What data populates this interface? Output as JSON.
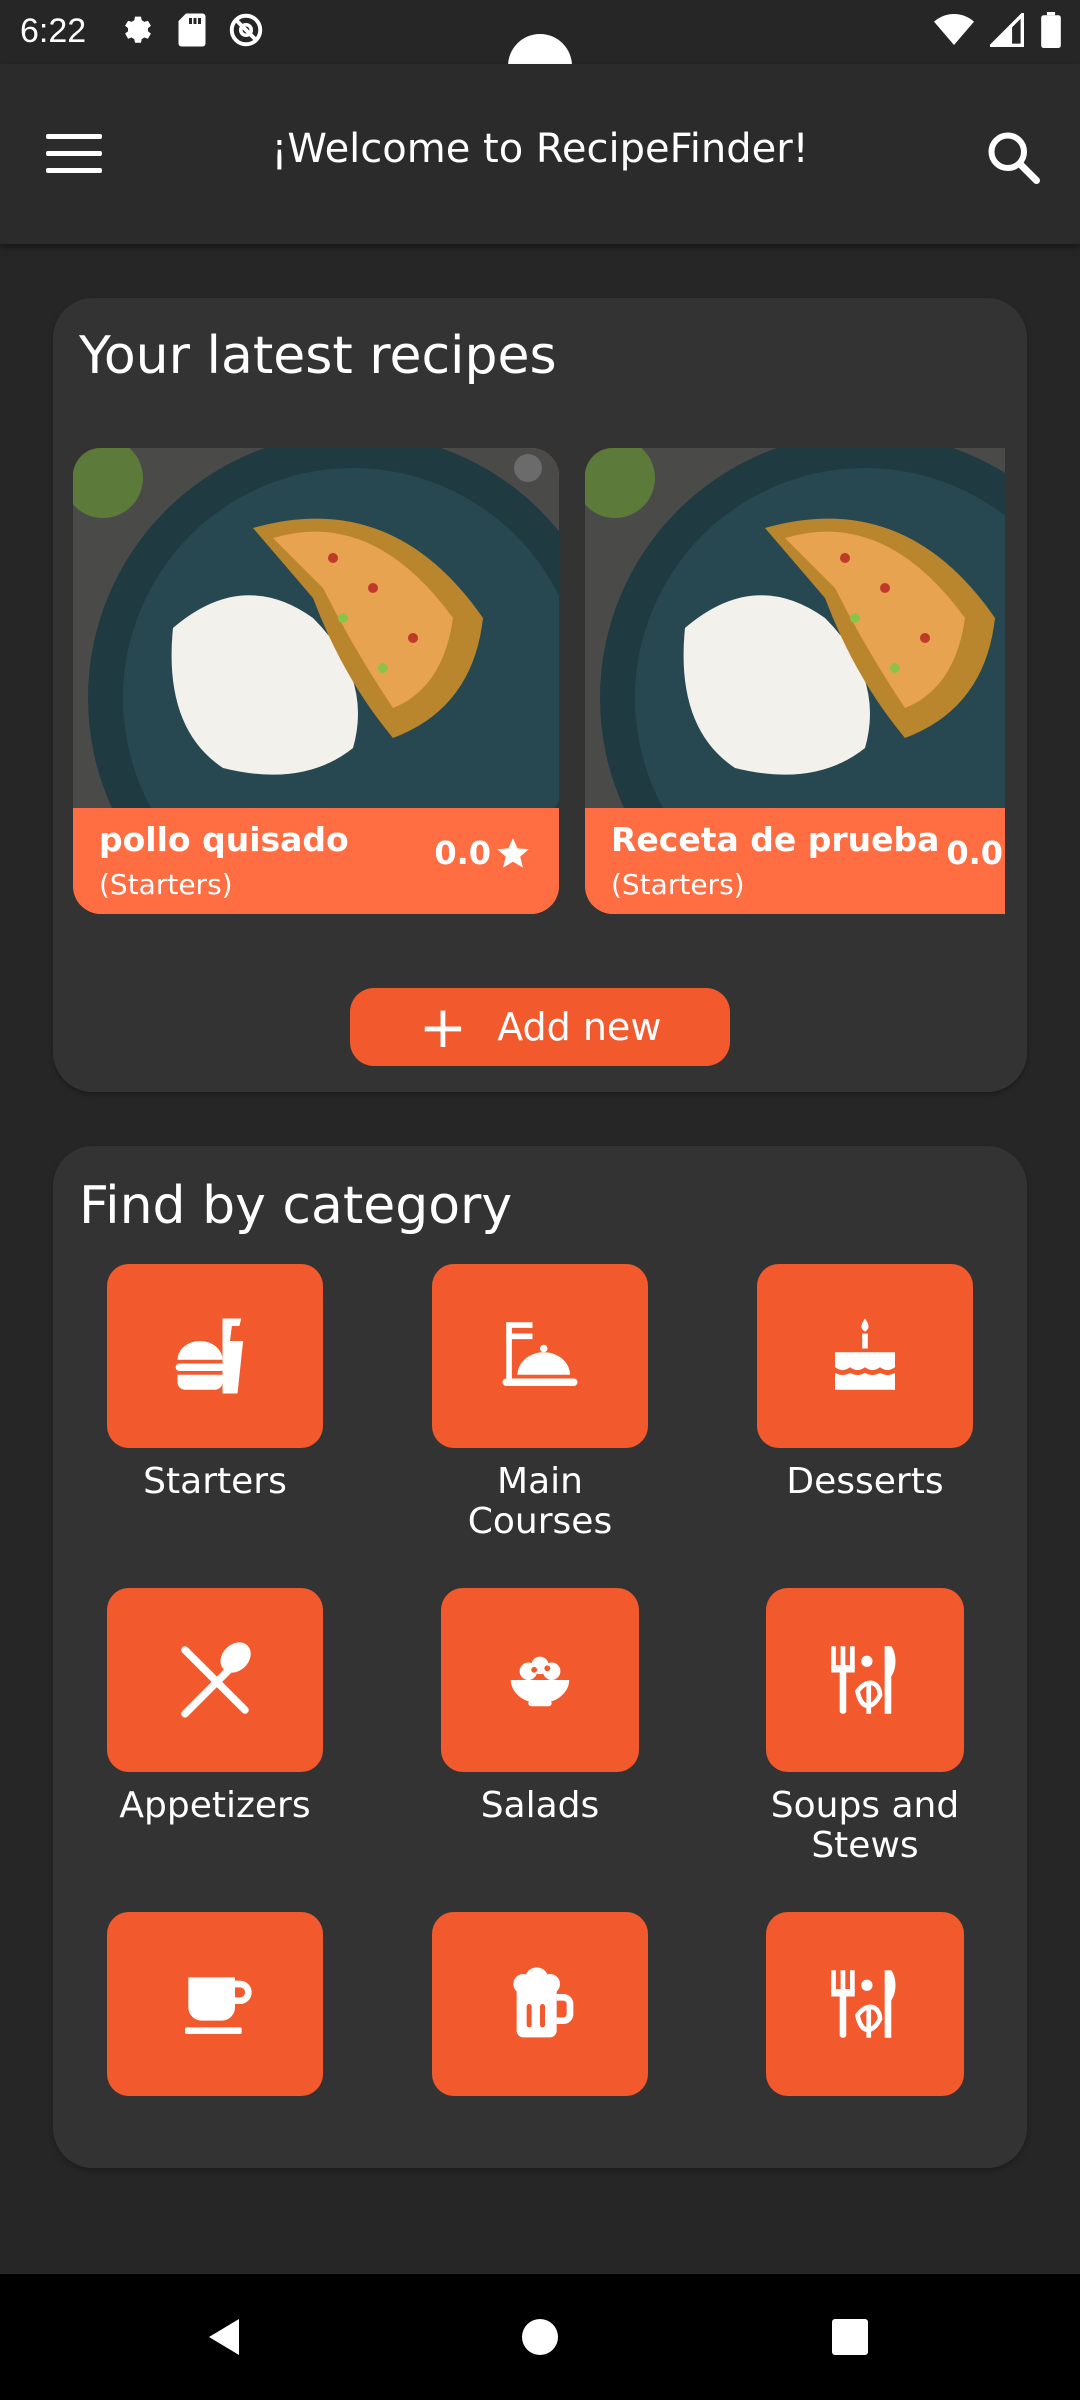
{
  "status_bar": {
    "time": "6:22",
    "left_icons": [
      "settings-icon",
      "sd-card-icon",
      "do-not-disturb-icon"
    ],
    "right_icons": [
      "wifi-icon",
      "signal-icon",
      "battery-icon"
    ]
  },
  "app_bar": {
    "title": "¡Welcome to RecipeFinder!",
    "menu_icon": "hamburger-menu-icon",
    "search_icon": "search-icon"
  },
  "latest_recipes": {
    "title": "Your latest recipes",
    "recipes": [
      {
        "name": "pollo quisado",
        "category": "(Starters)",
        "rating": "0.0",
        "image": "chicken-rice-photo"
      },
      {
        "name": "Receta de prueba",
        "category": "(Starters)",
        "rating": "0.0",
        "image": "chicken-rice-photo"
      }
    ],
    "add_button_label": "Add new"
  },
  "categories": {
    "title": "Find by category",
    "items": [
      {
        "label": "Starters",
        "icon": "burger-drink-icon"
      },
      {
        "label": "Main Courses",
        "icon": "cloche-serving-icon"
      },
      {
        "label": "Desserts",
        "icon": "birthday-cake-icon"
      },
      {
        "label": "Appetizers",
        "icon": "fork-spoon-icon"
      },
      {
        "label": "Salads",
        "icon": "salad-bowl-icon"
      },
      {
        "label": "Soups and Stews",
        "icon": "utensils-leaf-icon"
      },
      {
        "label": "",
        "icon": "coffee-cup-icon"
      },
      {
        "label": "",
        "icon": "beer-mug-icon"
      },
      {
        "label": "",
        "icon": "utensils-leaf-icon"
      }
    ]
  },
  "colors": {
    "background": "#262626",
    "card": "#333333",
    "accent": "#f25a2d",
    "recipe_footer": "#ff6e42"
  },
  "nav_bar": {
    "buttons": [
      "back-icon",
      "home-icon",
      "recents-icon"
    ]
  }
}
